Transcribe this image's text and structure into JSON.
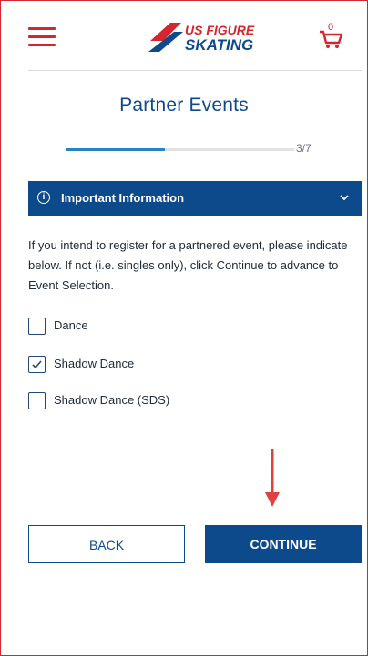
{
  "header": {
    "logo_line1": "US FIGURE",
    "logo_line2": "SKATING",
    "cart_count": "0"
  },
  "page": {
    "title": "Partner Events",
    "progress": {
      "label": "3/7",
      "fraction": 0.43
    }
  },
  "info_bar": {
    "label": "Important Information"
  },
  "description": "If you intend to register for a partnered event, please indicate below. If not (i.e. singles only), click Continue to advance to Event Selection.",
  "options": [
    {
      "label": "Dance",
      "checked": false
    },
    {
      "label": "Shadow Dance",
      "checked": true
    },
    {
      "label": "Shadow Dance (SDS)",
      "checked": false
    }
  ],
  "buttons": {
    "back": "BACK",
    "continue": "CONTINUE"
  },
  "colors": {
    "brand_red": "#d4262f",
    "brand_blue": "#0d4a8b",
    "progress_blue": "#2a81c6"
  }
}
